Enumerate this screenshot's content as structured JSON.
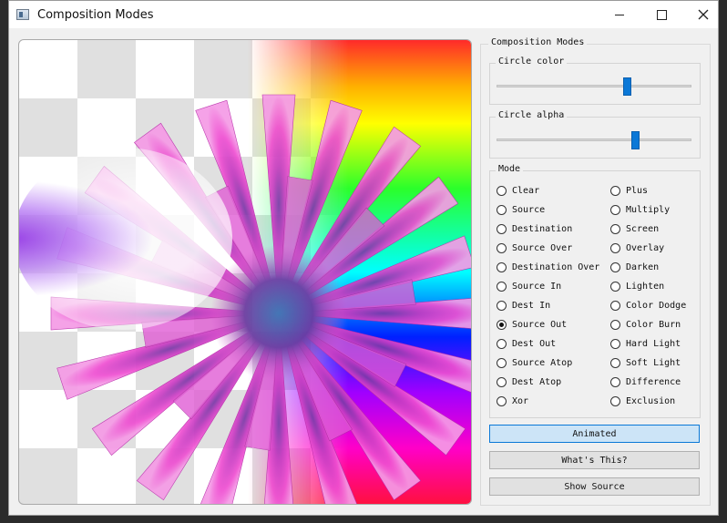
{
  "window": {
    "title": "Composition Modes",
    "minimize_icon": "minimize-icon",
    "maximize_icon": "maximize-icon",
    "close_icon": "close-icon"
  },
  "panel": {
    "title": "Composition Modes",
    "circle_color": {
      "label": "Circle color",
      "value_fraction": 0.68
    },
    "circle_alpha": {
      "label": "Circle alpha",
      "value_fraction": 0.72
    },
    "mode": {
      "label": "Mode",
      "selected": "Source Out",
      "left_column": [
        "Clear",
        "Source",
        "Destination",
        "Source Over",
        "Destination Over",
        "Source In",
        "Dest In",
        "Source Out",
        "Dest Out",
        "Source Atop",
        "Dest Atop",
        "Xor"
      ],
      "right_column": [
        "Plus",
        "Multiply",
        "Screen",
        "Overlay",
        "Darken",
        "Lighten",
        "Color Dodge",
        "Color Burn",
        "Hard Light",
        "Soft Light",
        "Difference",
        "Exclusion"
      ]
    },
    "buttons": {
      "animated": "Animated",
      "whats_this": "What's This?",
      "show_source": "Show Source"
    }
  },
  "colors": {
    "accent": "#0b78d7",
    "active_button": "#cce4f7",
    "circle": "#9b4be8"
  }
}
